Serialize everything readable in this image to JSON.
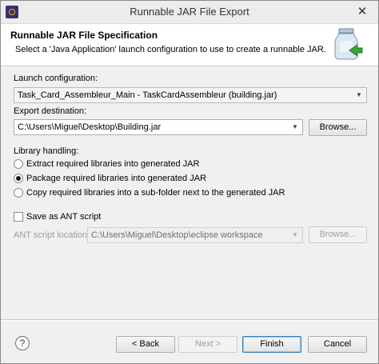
{
  "window": {
    "title": "Runnable JAR File Export"
  },
  "banner": {
    "title": "Runnable JAR File Specification",
    "description": "Select a 'Java Application' launch configuration to use to create a runnable JAR."
  },
  "launch": {
    "label": "Launch configuration:",
    "value": "Task_Card_Assembleur_Main - TaskCardAssembleur (building.jar)"
  },
  "export": {
    "label": "Export destination:",
    "value": "C:\\Users\\Miguel\\Desktop\\Building.jar",
    "browse": "Browse..."
  },
  "library": {
    "label": "Library handling:",
    "options": [
      {
        "label": "Extract required libraries into generated JAR",
        "checked": false
      },
      {
        "label": "Package required libraries into generated JAR",
        "checked": true
      },
      {
        "label": "Copy required libraries into a sub-folder next to the generated JAR",
        "checked": false
      }
    ]
  },
  "ant": {
    "checkbox_label": "Save as ANT script",
    "checked": false,
    "location_label": "ANT script location:",
    "location_value": "C:\\Users\\Miguel\\Desktop\\eclipse workspace",
    "browse": "Browse..."
  },
  "footer": {
    "back": "< Back",
    "next": "Next >",
    "finish": "Finish",
    "cancel": "Cancel"
  },
  "icons": {
    "close": "close-icon",
    "help": "help-icon",
    "jar": "jar-export-icon",
    "dropdown": "chevron-down-icon"
  }
}
